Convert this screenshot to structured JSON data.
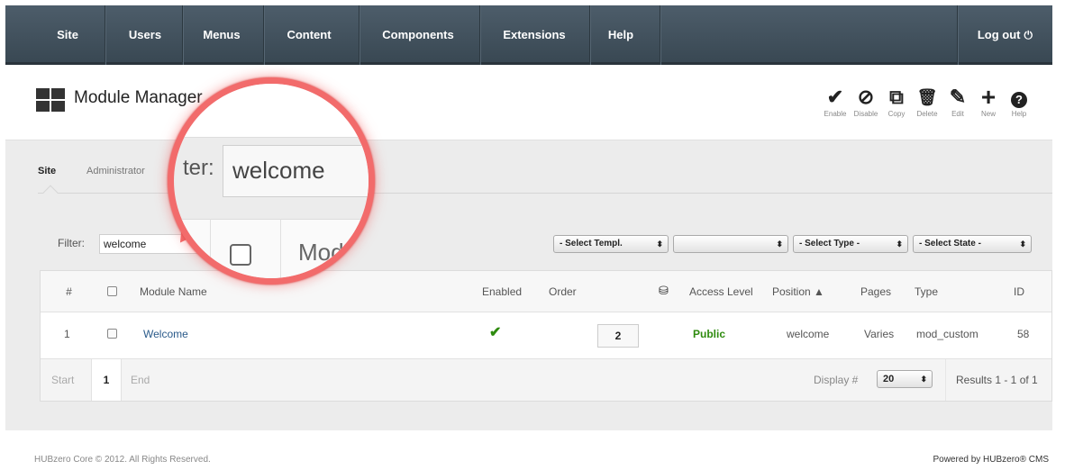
{
  "nav": {
    "items": [
      "Site",
      "Users",
      "Menus",
      "Content",
      "Components",
      "Extensions",
      "Help"
    ],
    "logout": "Log out"
  },
  "header": {
    "title": "Module Manager",
    "toolbar": [
      {
        "icon": "check-icon",
        "glyph": "✔",
        "label": "Enable"
      },
      {
        "icon": "disable-icon",
        "glyph": "⊘",
        "label": "Disable"
      },
      {
        "icon": "copy-icon",
        "glyph": "⧉",
        "label": "Copy"
      },
      {
        "icon": "trash-icon",
        "glyph": "🗑",
        "label": "Delete"
      },
      {
        "icon": "pencil-icon",
        "glyph": "✎",
        "label": "Edit"
      },
      {
        "icon": "plus-icon",
        "glyph": "+",
        "label": "New"
      },
      {
        "icon": "help-icon",
        "glyph": "?",
        "label": "Help"
      }
    ]
  },
  "tabs": [
    "Site",
    "Administrator"
  ],
  "filter": {
    "label": "Filter:",
    "value": "welcome"
  },
  "selects": [
    "- Select Templ.",
    "",
    "- Select Type -",
    "- Select State -"
  ],
  "table": {
    "headers": [
      "#",
      "",
      "Module Name",
      "Enabled",
      "Order",
      "",
      "Access Level",
      "Position ▲",
      "Pages",
      "Type",
      "ID"
    ],
    "rows": [
      {
        "num": "1",
        "name": "Welcome",
        "enabled": "✔",
        "order": "2",
        "access": "Public",
        "position": "welcome",
        "pages": "Varies",
        "type": "mod_custom",
        "id": "58"
      }
    ],
    "pagination": {
      "start": "Start",
      "page": "1",
      "end": "End"
    },
    "display_label": "Display #",
    "display_value": "20",
    "results": "Results 1 - 1 of 1"
  },
  "magnifier": {
    "label": "ter:",
    "value": "welcome",
    "column": "Mod"
  },
  "footer": {
    "left": "HUBzero Core © 2012. All Rights Reserved.",
    "right": "Powered by HUBzero® CMS"
  },
  "colors": {
    "nav_bg": "#434f5b",
    "accent_green": "#2e8b0e",
    "link_blue": "#2a5a8a",
    "magnifier_ring": "#f26b6b"
  }
}
